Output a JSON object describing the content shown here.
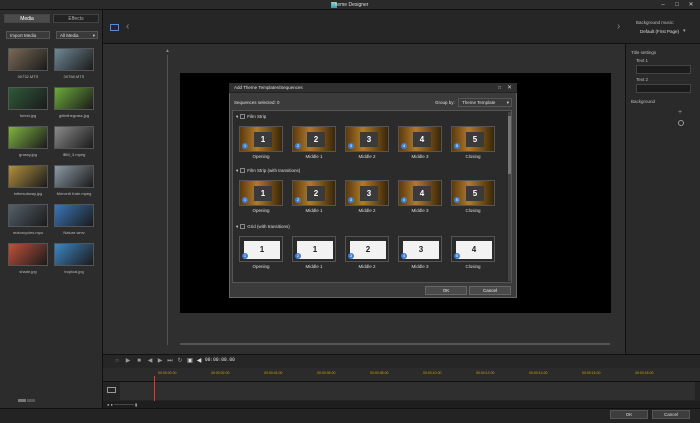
{
  "window": {
    "title": "Theme Designer",
    "minimize": "–",
    "maximize": "□",
    "close": "✕"
  },
  "left_panel": {
    "tabs": [
      "Media",
      "Effects"
    ],
    "import_button": "Import Media",
    "filter_dropdown": "All Media",
    "media": [
      {
        "name": "00732.MTS",
        "color": "#7a6a55"
      },
      {
        "name": "00768.MTS",
        "color": "#6e8896"
      },
      {
        "name": "forest.jpg",
        "color": "#2f5a3a"
      },
      {
        "name": "girlinthegrass.jpg",
        "color": "#6cab3b"
      },
      {
        "name": "grassy.jpg",
        "color": "#7fb440"
      },
      {
        "name": "IBM_3.mpeg",
        "color": "#8a8a8a"
      },
      {
        "name": "inthesubway.jpg",
        "color": "#b38f3f"
      },
      {
        "name": "Mercedi Kate.mpeg",
        "color": "#8b9aa6"
      },
      {
        "name": "motorcycles.mpo",
        "color": "#55606a"
      },
      {
        "name": "Nature.wmv",
        "color": "#3a76b8"
      },
      {
        "name": "shade.jpg",
        "color": "#c0513a"
      },
      {
        "name": "tropical.jpg",
        "color": "#3d86c4"
      }
    ]
  },
  "right_panel": {
    "background_music_label": "Background music:",
    "background_music_value": "Default (First Page)",
    "title_settings_label": "Title settings",
    "text1_label": "Text 1",
    "text2_label": "Text 2",
    "background_label": "Background"
  },
  "playback": {
    "timecode": "00:00:00.00"
  },
  "timeline": {
    "ruler_labels": [
      "00:00:00.00",
      "00:00:02.00",
      "00:00:04.00",
      "00:00:06.00",
      "00:00:08.00",
      "00:00:10.00",
      "00:00:12.00",
      "00:00:14.00",
      "00:00:16.00",
      "00:00:18.00"
    ]
  },
  "bottom": {
    "ok": "OK",
    "cancel": "Cancel"
  },
  "dialog": {
    "title": "Add Theme Templates/Sequences",
    "sequences_selected": "Sequences selected: 0",
    "group_by_label": "Group by:",
    "group_by_value": "Theme Template",
    "ok": "OK",
    "cancel": "Cancel",
    "groups": [
      {
        "name": "Film Strip",
        "style": "film",
        "items": [
          "Opening",
          "Middle 1",
          "Middle 2",
          "Middle 3",
          "Closing"
        ]
      },
      {
        "name": "Film Strip (with transitions)",
        "style": "film",
        "items": [
          "Opening",
          "Middle 1",
          "Middle 2",
          "Middle 3",
          "Closing"
        ]
      },
      {
        "name": "Grid (with transitions)",
        "style": "grid",
        "items": [
          "Opening",
          "Middle 1",
          "Middle 2",
          "Middle 3",
          "Closing"
        ]
      }
    ],
    "card_numbers": [
      "1",
      "2",
      "3",
      "4",
      "5"
    ]
  }
}
